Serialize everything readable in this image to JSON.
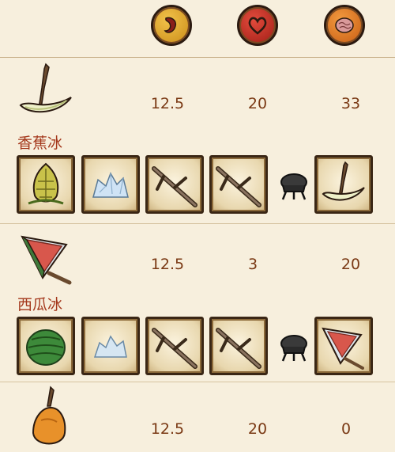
{
  "header": {
    "icons": [
      "hunger-stomach-icon",
      "health-heart-icon",
      "sanity-brain-icon"
    ]
  },
  "recipes": [
    {
      "name": "香蕉冰",
      "hunger": "12.5",
      "health": "20",
      "sanity": "33",
      "food_icon": "banana-pop-icon",
      "ingredients": [
        "pinecone-icon",
        "ice-icon",
        "twigs-icon",
        "twigs-icon"
      ],
      "cookware": "crock-pot-icon",
      "result": "banana-pop-icon"
    },
    {
      "name": "西瓜冰",
      "hunger": "12.5",
      "health": "3",
      "sanity": "20",
      "food_icon": "melonsicle-icon",
      "ingredients": [
        "watermelon-icon",
        "ice-icon",
        "twigs-icon",
        "twigs-icon"
      ],
      "cookware": "crock-pot-icon",
      "result": "melonsicle-icon"
    },
    {
      "name": "",
      "hunger": "12.5",
      "health": "20",
      "sanity": "0",
      "food_icon": "orange-food-icon"
    }
  ]
}
